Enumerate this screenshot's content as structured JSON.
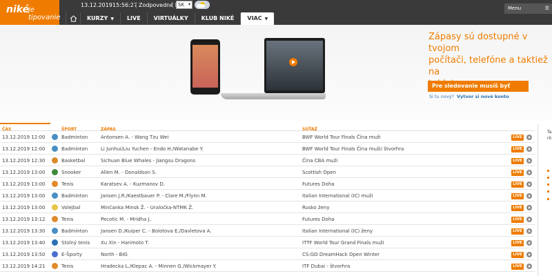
{
  "brand": {
    "name": "niké",
    "tagline": "je tipovanie",
    "accent": "#ef7c00",
    "bar_color": "#3a3a3a"
  },
  "topbar": {
    "date": "13.12.2019",
    "time": "15:56:27",
    "responsible": "Zodpovedné hranie",
    "language": "SK",
    "menu_label": "Menu"
  },
  "nav": {
    "items": [
      {
        "label": "KURZY",
        "has_dropdown": true
      },
      {
        "label": "LIVE",
        "has_dropdown": false
      },
      {
        "label": "VIRTUÁLKY",
        "has_dropdown": false
      },
      {
        "label": "KLUB NIKÉ",
        "has_dropdown": false
      },
      {
        "label": "VIAC",
        "has_dropdown": true,
        "active": true
      }
    ]
  },
  "hero": {
    "text_lines": [
      "Zápasy sú dostupné v tvojom",
      "počítači, telefóne a taktiež na",
      "tablete."
    ],
    "cta": "Pre sledovanie musíš byť prihlásený.",
    "register_question": "Si tu nový?",
    "register_link": "Vytvor si nové konto"
  },
  "table": {
    "headers": {
      "time": "ČAS",
      "sport": "ŠPORT",
      "match": "ZÁPAS",
      "competition": "SÚŤAŽ"
    },
    "live_label": "LIVE",
    "rows": [
      {
        "time": "13.12.2019 12:00",
        "sport": "Badminton",
        "icon": "badminton-icon",
        "match": "Antonsen A. - Wang Tzu Wei",
        "competition": "BWF World Tour Finals Čína muži"
      },
      {
        "time": "13.12.2019 12:00",
        "sport": "Badminton",
        "icon": "badminton-icon",
        "match": "Li Junhui/Liu Yuchen - Endo H./Watanabe Y.",
        "competition": "BWF World Tour Finals Čína muži/ štvorhra"
      },
      {
        "time": "13.12.2019 12:30",
        "sport": "Basketbal",
        "icon": "basketball-icon",
        "match": "Sichuan Blue Whales - Jiangsu Dragons",
        "competition": "Čína CBA muži"
      },
      {
        "time": "13.12.2019 13:00",
        "sport": "Snooker",
        "icon": "snooker-icon",
        "match": "Allen M. - Donaldson S.",
        "competition": "Scottish Open"
      },
      {
        "time": "13.12.2019 13:00",
        "sport": "Tenis",
        "icon": "tennis-icon",
        "match": "Karatsev A. - Kuzmanov D.",
        "competition": "Futures Doha"
      },
      {
        "time": "13.12.2019 13:00",
        "sport": "Badminton",
        "icon": "badminton-icon",
        "match": "Jansen J.R./Kaestbauer P. - Clare M./Flynn M.",
        "competition": "Italian International (IC) muži"
      },
      {
        "time": "13.12.2019 13:00",
        "sport": "Volejbal",
        "icon": "volleyball-icon",
        "match": "Minčanka Minsk Ž. - Uraločka-NTMK Ž.",
        "competition": "Rusko ženy"
      },
      {
        "time": "13.12.2019 13:12",
        "sport": "Tenis",
        "icon": "tennis-icon",
        "match": "Pecotic M. - Mridha J.",
        "competition": "Futures Doha"
      },
      {
        "time": "13.12.2019 13:30",
        "sport": "Badminton",
        "icon": "badminton-icon",
        "match": "Jansen D./Kuiper C. - Bolotova E./Davletova A.",
        "competition": "Italian International (IC) ženy"
      },
      {
        "time": "13.12.2019 13:40",
        "sport": "Stolný tenis",
        "icon": "table-tennis-icon",
        "match": "Xu Xin - Harimoto T.",
        "competition": "ITTF World Tour Grand Finals muži"
      },
      {
        "time": "13.12.2019 13:50",
        "sport": "E-Športy",
        "icon": "esports-icon",
        "match": "North - BIG",
        "competition": "CS:GO DreamHack Open Winter"
      },
      {
        "time": "13.12.2019 14:21",
        "sport": "Tenis",
        "icon": "tennis-icon",
        "match": "Hradecka L./Klepac A. - Minnen G./Wickmayer Y.",
        "competition": "ITF Dubai - štvorhra"
      }
    ]
  },
  "side_panel": {
    "line1": "Ta",
    "line2": "rô"
  },
  "icon_colors": {
    "badminton-icon": "#4a8fc4",
    "basketball-icon": "#d98a2b",
    "snooker-icon": "#3d8a3d",
    "tennis-icon": "#e08a2a",
    "volleyball-icon": "#e9c54a",
    "table-tennis-icon": "#2e6fb5",
    "esports-icon": "#4a6fd0"
  }
}
